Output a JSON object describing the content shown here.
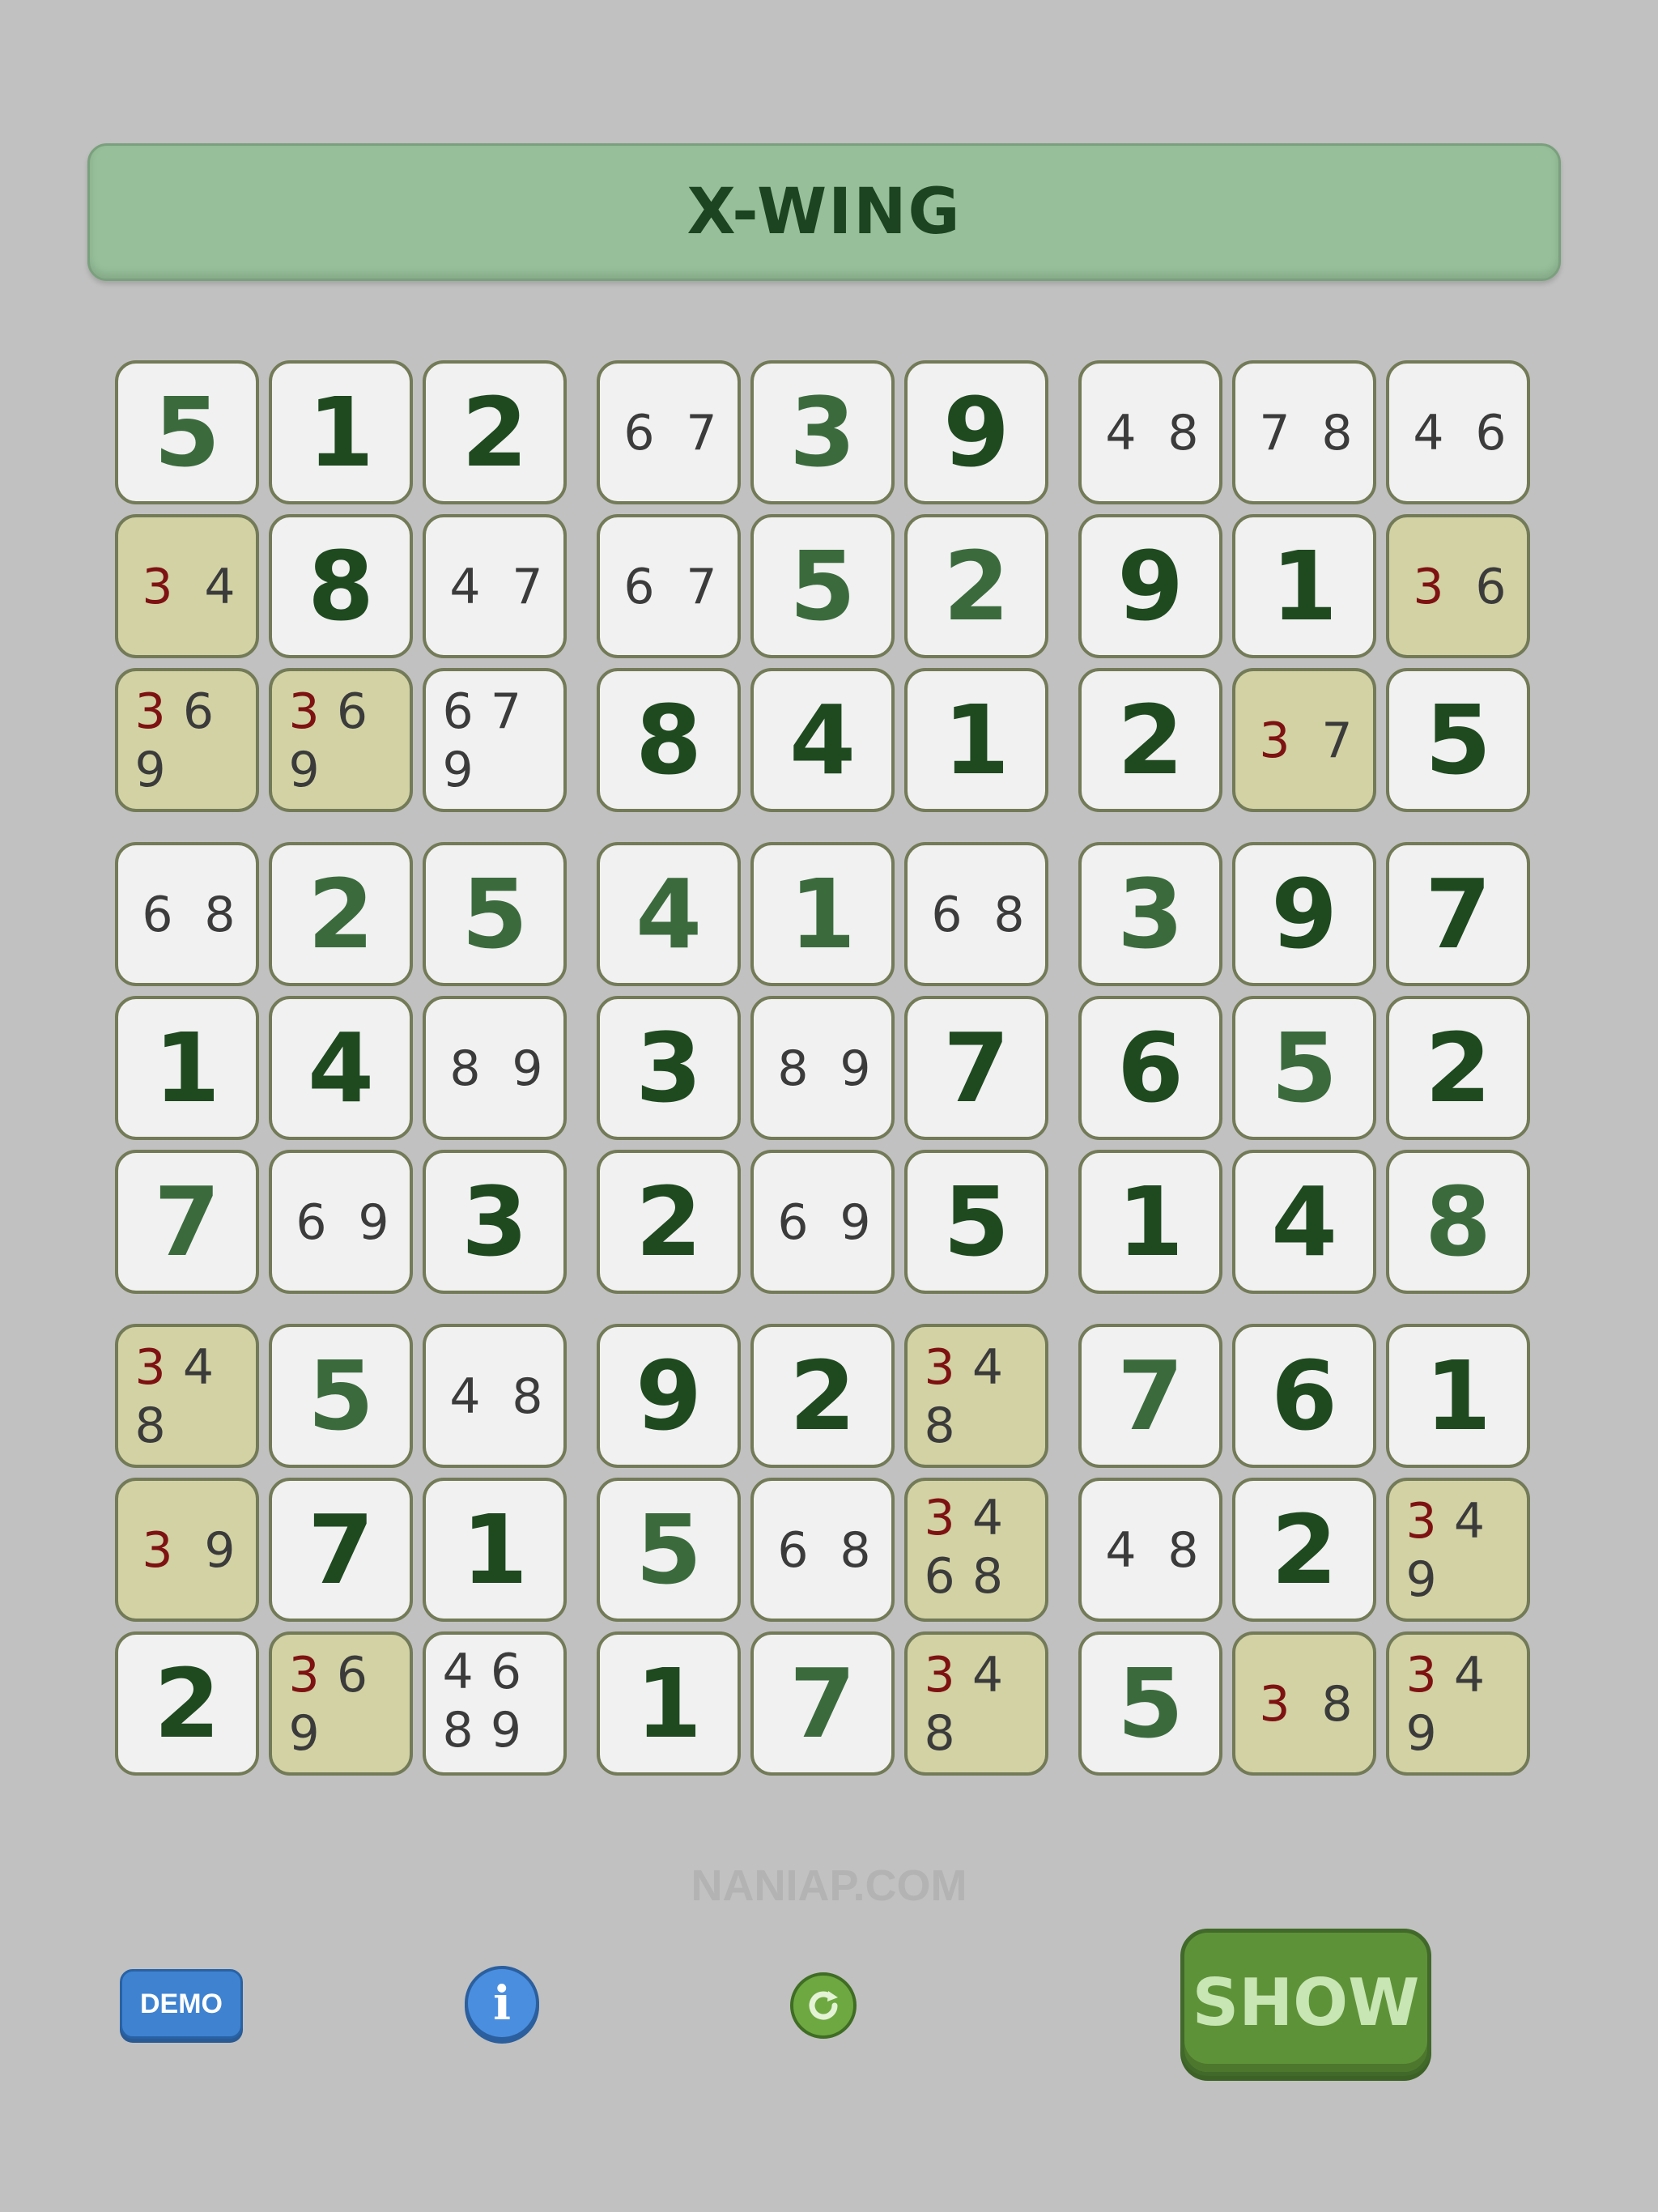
{
  "title": "X-WING",
  "watermark": "NANIAP.COM",
  "buttons": {
    "demo_label": "DEMO",
    "info_label": "i",
    "refresh_icon": "refresh-icon",
    "show_label": "SHOW"
  },
  "colors": {
    "background": "#c1c1c1",
    "title_bar": "#97c09a",
    "cell": "#f1f1f1",
    "highlight_cell": "#d2d2a4",
    "given_digit": "#1f4a20",
    "candidate": "#3b3b3b",
    "highlight_candidate": "#7e1212"
  },
  "highlight_candidate": "3",
  "board": [
    [
      {
        "v": "5"
      },
      {
        "v": "1"
      },
      {
        "v": "2"
      },
      {
        "c": [
          "6",
          "7"
        ]
      },
      {
        "v": "3"
      },
      {
        "v": "9"
      },
      {
        "c": [
          "4",
          "8"
        ]
      },
      {
        "c": [
          "7",
          "8"
        ]
      },
      {
        "c": [
          "4",
          "6"
        ]
      }
    ],
    [
      {
        "c": [
          "3",
          "4"
        ],
        "hl": true
      },
      {
        "v": "8"
      },
      {
        "c": [
          "4",
          "7"
        ]
      },
      {
        "c": [
          "6",
          "7"
        ]
      },
      {
        "v": "5"
      },
      {
        "v": "2"
      },
      {
        "v": "9"
      },
      {
        "v": "1"
      },
      {
        "c": [
          "3",
          "6"
        ],
        "hl": true
      }
    ],
    [
      {
        "c": [
          "3",
          "6",
          "9"
        ],
        "hl": true
      },
      {
        "c": [
          "3",
          "6",
          "9"
        ],
        "hl": true
      },
      {
        "c": [
          "6",
          "7",
          "9"
        ]
      },
      {
        "v": "8"
      },
      {
        "v": "4"
      },
      {
        "v": "1"
      },
      {
        "v": "2"
      },
      {
        "c": [
          "3",
          "7"
        ],
        "hl": true
      },
      {
        "v": "5"
      }
    ],
    [
      {
        "c": [
          "6",
          "8"
        ]
      },
      {
        "v": "2"
      },
      {
        "v": "5"
      },
      {
        "v": "4"
      },
      {
        "v": "1"
      },
      {
        "c": [
          "6",
          "8"
        ]
      },
      {
        "v": "3"
      },
      {
        "v": "9"
      },
      {
        "v": "7"
      }
    ],
    [
      {
        "v": "1"
      },
      {
        "v": "4"
      },
      {
        "c": [
          "8",
          "9"
        ]
      },
      {
        "v": "3"
      },
      {
        "c": [
          "8",
          "9"
        ]
      },
      {
        "v": "7"
      },
      {
        "v": "6"
      },
      {
        "v": "5"
      },
      {
        "v": "2"
      }
    ],
    [
      {
        "v": "7"
      },
      {
        "c": [
          "6",
          "9"
        ]
      },
      {
        "v": "3"
      },
      {
        "v": "2"
      },
      {
        "c": [
          "6",
          "9"
        ]
      },
      {
        "v": "5"
      },
      {
        "v": "1"
      },
      {
        "v": "4"
      },
      {
        "v": "8"
      }
    ],
    [
      {
        "c": [
          "3",
          "4",
          "8"
        ],
        "hl": true
      },
      {
        "v": "5"
      },
      {
        "c": [
          "4",
          "8"
        ]
      },
      {
        "v": "9"
      },
      {
        "v": "2"
      },
      {
        "c": [
          "3",
          "4",
          "8"
        ],
        "hl": true
      },
      {
        "v": "7"
      },
      {
        "v": "6"
      },
      {
        "v": "1"
      }
    ],
    [
      {
        "c": [
          "3",
          "9"
        ],
        "hl": true
      },
      {
        "v": "7"
      },
      {
        "v": "1"
      },
      {
        "v": "5"
      },
      {
        "c": [
          "6",
          "8"
        ]
      },
      {
        "c": [
          "3",
          "4",
          "6",
          "8"
        ],
        "hl": true
      },
      {
        "c": [
          "4",
          "8"
        ]
      },
      {
        "v": "2"
      },
      {
        "c": [
          "3",
          "4",
          "9"
        ],
        "hl": true
      }
    ],
    [
      {
        "v": "2"
      },
      {
        "c": [
          "3",
          "6",
          "9"
        ],
        "hl": true
      },
      {
        "c": [
          "4",
          "6",
          "8",
          "9"
        ]
      },
      {
        "v": "1"
      },
      {
        "v": "7"
      },
      {
        "c": [
          "3",
          "4",
          "8"
        ],
        "hl": true
      },
      {
        "v": "5"
      },
      {
        "c": [
          "3",
          "8"
        ],
        "hl": true
      },
      {
        "c": [
          "3",
          "4",
          "9"
        ],
        "hl": true
      }
    ]
  ]
}
